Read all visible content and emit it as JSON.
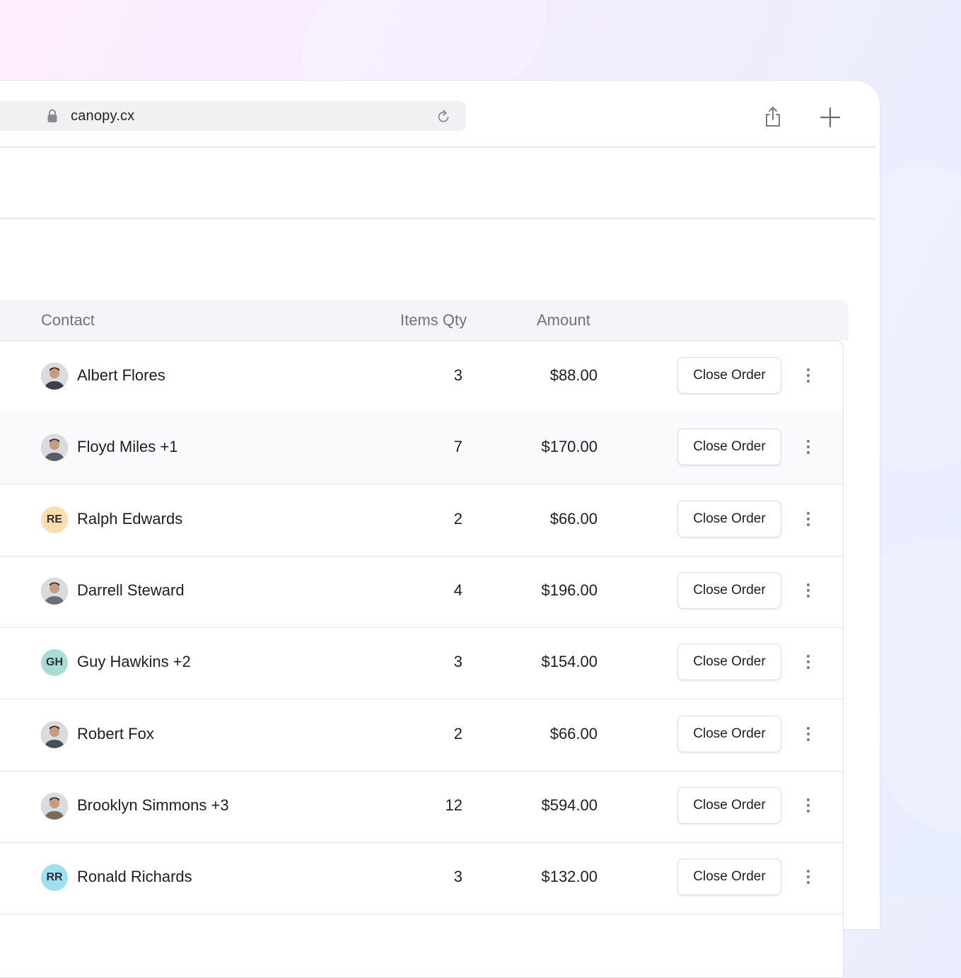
{
  "browser": {
    "url": "canopy.cx"
  },
  "table": {
    "headers": {
      "contact": "Contact",
      "qty": "Items Qty",
      "amount": "Amount"
    },
    "action_label": "Close Order",
    "rows": [
      {
        "name": "Albert Flores",
        "qty": "3",
        "amount": "$88.00",
        "avatar": "photo",
        "initials": "",
        "color": "#3a3f4a"
      },
      {
        "name": "Floyd Miles +1",
        "qty": "7",
        "amount": "$170.00",
        "avatar": "photo",
        "initials": "",
        "color": "#5a5f66"
      },
      {
        "name": "Ralph Edwards",
        "qty": "2",
        "amount": "$66.00",
        "avatar": "initials",
        "initials": "RE",
        "color": "#fddcaf"
      },
      {
        "name": "Darrell Steward",
        "qty": "4",
        "amount": "$196.00",
        "avatar": "photo",
        "initials": "",
        "color": "#6c6f78"
      },
      {
        "name": "Guy Hawkins +2",
        "qty": "3",
        "amount": "$154.00",
        "avatar": "initials",
        "initials": "GH",
        "color": "#a9dcd2"
      },
      {
        "name": "Robert Fox",
        "qty": "2",
        "amount": "$66.00",
        "avatar": "photo",
        "initials": "",
        "color": "#46505a"
      },
      {
        "name": "Brooklyn Simmons +3",
        "qty": "12",
        "amount": "$594.00",
        "avatar": "photo",
        "initials": "",
        "color": "#7a6a5a"
      },
      {
        "name": "Ronald Richards",
        "qty": "3",
        "amount": "$132.00",
        "avatar": "initials",
        "initials": "RR",
        "color": "#9fdff2"
      }
    ]
  },
  "icons": {
    "lock": "lock-icon",
    "reload": "reload-icon",
    "share": "share-icon",
    "new_tab": "plus-icon",
    "row_menu": "kebab-menu-icon"
  }
}
